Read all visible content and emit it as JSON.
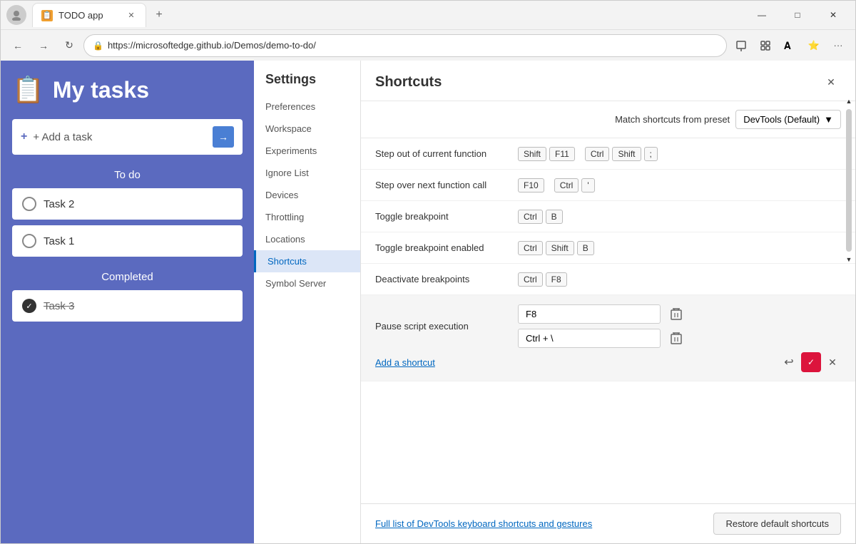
{
  "browser": {
    "tab_title": "TODO app",
    "tab_favicon": "📋",
    "address": "https://microsoftedge.github.io/Demos/demo-to-do/",
    "new_tab_symbol": "+",
    "minimize": "—",
    "maximize": "□",
    "close": "✕",
    "back": "←",
    "forward": "→",
    "refresh": "↻"
  },
  "todo": {
    "icon": "📋",
    "title": "My tasks",
    "add_task_label": "+ Add a task",
    "add_task_arrow": "→",
    "todo_section": "To do",
    "completed_section": "Completed",
    "tasks": [
      {
        "id": "task2",
        "text": "Task 2",
        "completed": false
      },
      {
        "id": "task1",
        "text": "Task 1",
        "completed": false
      }
    ],
    "completed_tasks": [
      {
        "id": "task3",
        "text": "Task 3",
        "completed": true
      }
    ]
  },
  "settings": {
    "title": "Settings",
    "nav_items": [
      {
        "id": "preferences",
        "label": "Preferences"
      },
      {
        "id": "workspace",
        "label": "Workspace"
      },
      {
        "id": "experiments",
        "label": "Experiments"
      },
      {
        "id": "ignore-list",
        "label": "Ignore List"
      },
      {
        "id": "devices",
        "label": "Devices"
      },
      {
        "id": "throttling",
        "label": "Throttling"
      },
      {
        "id": "locations",
        "label": "Locations"
      },
      {
        "id": "shortcuts",
        "label": "Shortcuts"
      },
      {
        "id": "symbol-server",
        "label": "Symbol Server"
      }
    ],
    "active_item": "shortcuts"
  },
  "shortcuts": {
    "title": "Shortcuts",
    "close_icon": "✕",
    "preset_label": "Match shortcuts from preset",
    "preset_value": "DevTools (Default)",
    "preset_arrow": "▼",
    "items": [
      {
        "id": "step-out",
        "name": "Step out of current function",
        "keys": [
          [
            "Shift",
            "F11"
          ],
          [
            "Ctrl",
            "Shift",
            ";"
          ]
        ]
      },
      {
        "id": "step-over",
        "name": "Step over next function call",
        "keys": [
          [
            "F10"
          ],
          [
            "Ctrl",
            "'"
          ]
        ]
      },
      {
        "id": "toggle-breakpoint",
        "name": "Toggle breakpoint",
        "keys": [
          [
            "Ctrl",
            "B"
          ]
        ]
      },
      {
        "id": "toggle-breakpoint-enabled",
        "name": "Toggle breakpoint enabled",
        "keys": [
          [
            "Ctrl",
            "Shift",
            "B"
          ]
        ]
      },
      {
        "id": "deactivate-breakpoints",
        "name": "Deactivate breakpoints",
        "keys": [
          [
            "Ctrl",
            "F8"
          ]
        ]
      }
    ],
    "editing_item": {
      "id": "pause-script",
      "name": "Pause script execution",
      "inputs": [
        "F8",
        "Ctrl + \\"
      ],
      "add_shortcut_label": "Add a shortcut",
      "delete_icon": "🗑",
      "undo_icon": "↩",
      "confirm_icon": "✓",
      "cancel_icon": "✕"
    },
    "footer_link": "Full list of DevTools keyboard shortcuts and gestures",
    "restore_btn": "Restore default shortcuts"
  }
}
